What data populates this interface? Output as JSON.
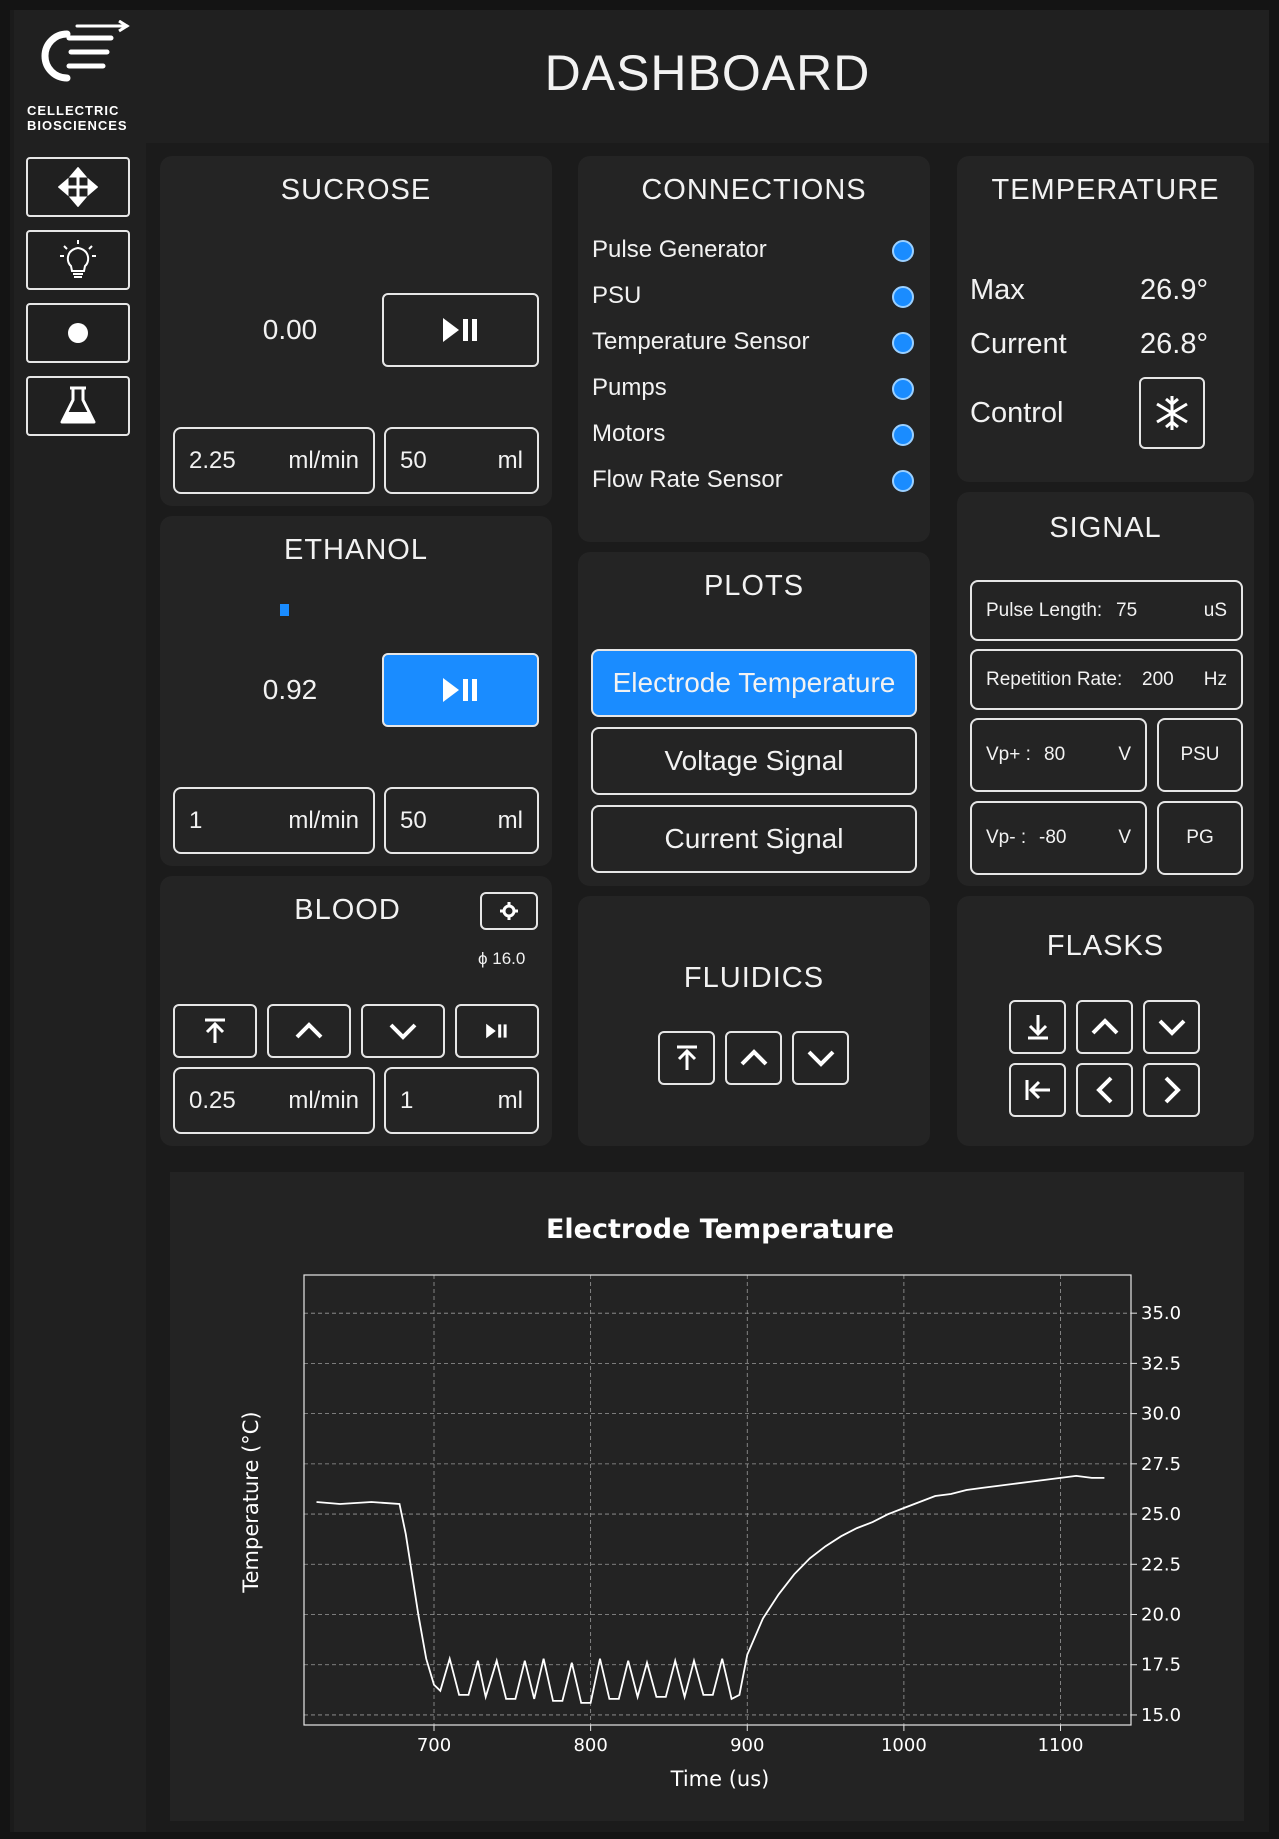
{
  "brand": {
    "line1": "CELLECTRIC",
    "line2": "BIOSCIENCES"
  },
  "header": {
    "title": "DASHBOARD"
  },
  "sidebar": {
    "items": [
      {
        "icon": "move-icon"
      },
      {
        "icon": "lightbulb-icon"
      },
      {
        "icon": "record-icon"
      },
      {
        "icon": "flask-icon"
      }
    ]
  },
  "sucrose": {
    "title": "SUCROSE",
    "value": "0.00",
    "flow": "2.25",
    "flow_unit": "ml/min",
    "volume": "50",
    "volume_unit": "ml"
  },
  "ethanol": {
    "title": "ETHANOL",
    "value": "0.92",
    "flow": "1",
    "flow_unit": "ml/min",
    "volume": "50",
    "volume_unit": "ml",
    "progress": 0.03
  },
  "blood": {
    "title": "BLOOD",
    "phi": "ϕ 16.0",
    "flow": "0.25",
    "flow_unit": "ml/min",
    "volume": "1",
    "volume_unit": "ml"
  },
  "connections": {
    "title": "CONNECTIONS",
    "items": [
      "Pulse Generator",
      "PSU",
      "Temperature Sensor",
      "Pumps",
      "Motors",
      "Flow Rate Sensor"
    ],
    "status_color": "#1a8cff"
  },
  "plots": {
    "title": "PLOTS",
    "buttons": [
      "Electrode Temperature",
      "Voltage Signal",
      "Current Signal"
    ],
    "active": "Electrode Temperature"
  },
  "fluidics": {
    "title": "FLUIDICS"
  },
  "temperature": {
    "title": "TEMPERATURE",
    "max_label": "Max",
    "max_value": "26.9°",
    "current_label": "Current",
    "current_value": "26.8°",
    "control_label": "Control"
  },
  "signal": {
    "title": "SIGNAL",
    "pulse_label": "Pulse Length:",
    "pulse_value": "75",
    "pulse_unit": "uS",
    "rep_label": "Repetition Rate:",
    "rep_value": "200",
    "rep_unit": "Hz",
    "vpp_label": "Vp+ :",
    "vpp_value": "80",
    "vpp_unit": "V",
    "vpm_label": "Vp- :",
    "vpm_value": "-80",
    "vpm_unit": "V",
    "psu_label": "PSU",
    "pg_label": "PG"
  },
  "flasks": {
    "title": "FLASKS"
  },
  "colors": {
    "accent": "#1a8cff",
    "panel": "#242424",
    "background": "#141414"
  },
  "chart_data": {
    "type": "line",
    "title": "Electrode Temperature",
    "xlabel": "Time (us)",
    "ylabel": "Temperature (°C)",
    "xlim": [
      617,
      1145
    ],
    "ylim": [
      14.5,
      36.9
    ],
    "xticks": [
      700,
      800,
      900,
      1000,
      1100
    ],
    "yticks": [
      15.0,
      17.5,
      20.0,
      22.5,
      25.0,
      27.5,
      30.0,
      32.5,
      35.0
    ],
    "grid": true,
    "y_axis_side": "right",
    "series": [
      {
        "x": [
          625,
          640,
          660,
          678,
          682,
          690,
          695,
          700,
          704,
          710,
          716,
          722,
          728,
          733,
          740,
          746,
          752,
          758,
          764,
          770,
          776,
          782,
          788,
          794,
          800,
          806,
          812,
          818,
          824,
          830,
          836,
          842,
          848,
          854,
          860,
          866,
          872,
          878,
          884,
          890,
          895,
          900,
          910,
          920,
          930,
          940,
          950,
          960,
          970,
          980,
          990,
          1000,
          1010,
          1020,
          1030,
          1040,
          1050,
          1060,
          1070,
          1080,
          1090,
          1100,
          1110,
          1120,
          1128
        ],
        "y": [
          25.6,
          25.5,
          25.6,
          25.5,
          24.0,
          20.0,
          17.8,
          16.5,
          16.2,
          17.8,
          16.0,
          16.0,
          17.7,
          15.9,
          17.7,
          15.8,
          15.8,
          17.7,
          15.8,
          17.8,
          15.7,
          15.7,
          17.6,
          15.6,
          15.6,
          17.8,
          15.8,
          15.8,
          17.7,
          15.9,
          17.6,
          15.9,
          15.9,
          17.7,
          15.9,
          17.7,
          16.0,
          16.0,
          17.8,
          15.8,
          16.0,
          18.0,
          19.8,
          21.0,
          22.0,
          22.8,
          23.4,
          23.9,
          24.3,
          24.6,
          25.0,
          25.3,
          25.6,
          25.9,
          26.0,
          26.2,
          26.3,
          26.4,
          26.5,
          26.6,
          26.7,
          26.8,
          26.9,
          26.8,
          26.8
        ]
      }
    ]
  }
}
